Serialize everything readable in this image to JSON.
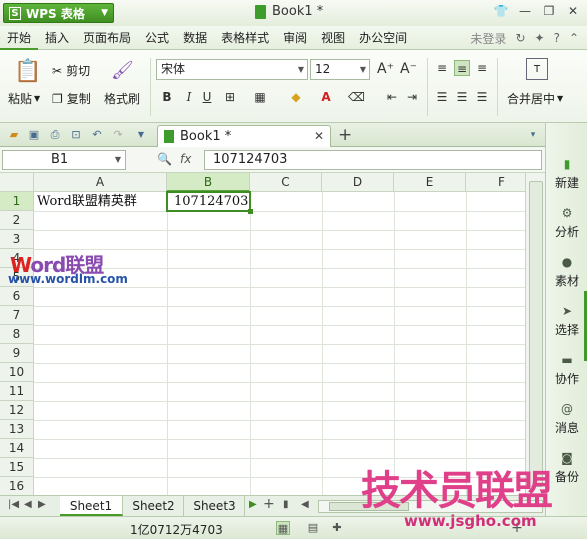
{
  "titlebar": {
    "app_name": "WPS 表格",
    "logo_glyph": "S",
    "doc_title": "Book1 *"
  },
  "menu": {
    "items": [
      "开始",
      "插入",
      "页面布局",
      "公式",
      "数据",
      "表格样式",
      "审阅",
      "视图",
      "办公空间"
    ],
    "active": "开始",
    "login": "未登录"
  },
  "ribbon": {
    "paste": "粘贴",
    "cut": "剪切",
    "copy": "复制",
    "format_painter": "格式刷",
    "font_name": "宋体",
    "font_size": "12",
    "bold": "B",
    "italic": "I",
    "underline": "U",
    "merge_center": "合并居中"
  },
  "tabbar": {
    "doc_tab": "Book1 *"
  },
  "formula_bar": {
    "name_box": "B1",
    "fx": "fx",
    "value": "107124703"
  },
  "grid": {
    "columns": [
      "A",
      "B",
      "C",
      "D",
      "E",
      "F"
    ],
    "rows": [
      "1",
      "2",
      "3",
      "4",
      "5",
      "6",
      "7",
      "8",
      "9",
      "10",
      "11",
      "12",
      "13",
      "14",
      "15",
      "16"
    ],
    "selected_column": "B",
    "selected_row": "1",
    "cells": {
      "A1": "Word联盟精英群",
      "B1": "107124703"
    }
  },
  "watermark": {
    "word_red": "W",
    "word_rest": "ord",
    "cn": "联盟",
    "url": "www.wordlm.com",
    "site_cn": "技术员联盟",
    "site_url": "www.jsgho.com"
  },
  "right_panel": {
    "items": [
      {
        "label": "新建",
        "icon": "new-doc-icon"
      },
      {
        "label": "分析",
        "icon": "analysis-icon"
      },
      {
        "label": "素材",
        "icon": "material-icon"
      },
      {
        "label": "选择",
        "icon": "select-icon"
      },
      {
        "label": "协作",
        "icon": "collab-icon"
      },
      {
        "label": "消息",
        "icon": "message-icon"
      },
      {
        "label": "备份",
        "icon": "backup-icon"
      }
    ]
  },
  "sheets": {
    "tabs": [
      "Sheet1",
      "Sheet2",
      "Sheet3"
    ],
    "active": "Sheet1"
  },
  "status": {
    "sum_text": "1亿0712万4703"
  },
  "colors": {
    "accent": "#3d8d22",
    "app_button": "#4ea22e"
  }
}
